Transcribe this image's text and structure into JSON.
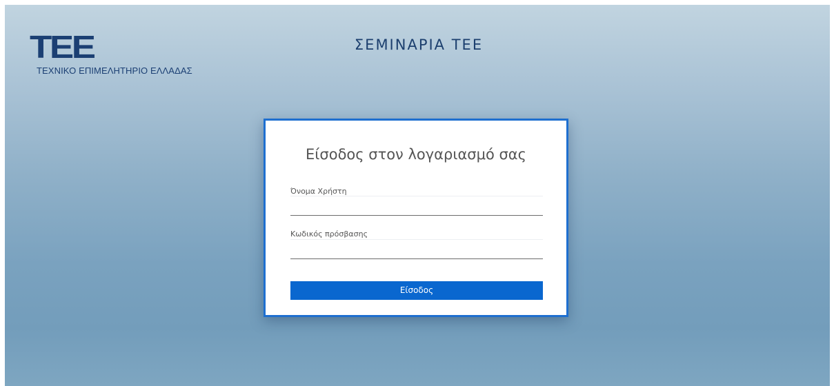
{
  "header": {
    "logo_mark": "ΤΕΕ",
    "logo_subtitle": "ΤΕΧΝΙΚΟ ΕΠΙΜΕΛΗΤΗΡΙΟ ΕΛΛΑΔΑΣ",
    "site_title": "ΣΕΜΙΝΑΡΙΑ ΤΕΕ"
  },
  "login": {
    "title": "Είσοδος στον λογαριασμό σας",
    "username_label": "Όνομα Χρήστη",
    "username_value": "",
    "password_label": "Κωδικός πρόσβασης",
    "password_value": "",
    "submit_label": "Είσοδος"
  },
  "colors": {
    "brand_navy": "#1b3f73",
    "accent_blue": "#0a67cf",
    "card_border": "#1e6fd0"
  }
}
